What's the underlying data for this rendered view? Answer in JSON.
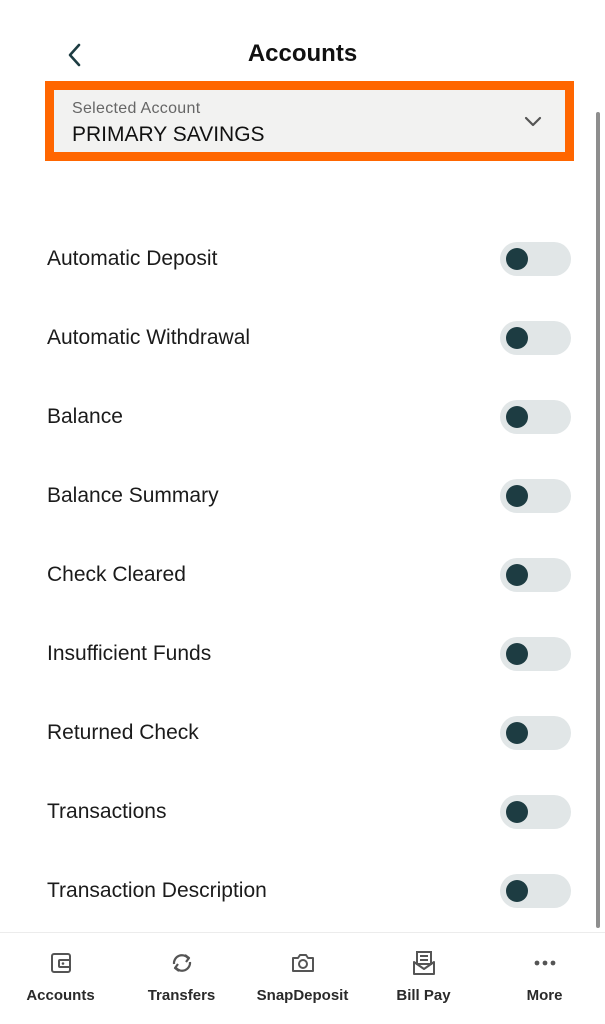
{
  "header": {
    "title": "Accounts",
    "back_icon": "chevron-left-icon"
  },
  "account_selector": {
    "label": "Selected Account",
    "value": "PRIMARY SAVINGS",
    "icon": "chevron-down-icon",
    "highlight_color": "#ff6600"
  },
  "alerts": [
    {
      "label": "Automatic Deposit",
      "enabled": false
    },
    {
      "label": "Automatic Withdrawal",
      "enabled": false
    },
    {
      "label": "Balance",
      "enabled": false
    },
    {
      "label": "Balance Summary",
      "enabled": false
    },
    {
      "label": "Check Cleared",
      "enabled": false
    },
    {
      "label": "Insufficient Funds",
      "enabled": false
    },
    {
      "label": "Returned Check",
      "enabled": false
    },
    {
      "label": "Transactions",
      "enabled": false
    },
    {
      "label": "Transaction Description",
      "enabled": false
    }
  ],
  "tabbar": {
    "items": [
      {
        "label": "Accounts",
        "icon": "wallet-icon"
      },
      {
        "label": "Transfers",
        "icon": "transfer-arrows-icon"
      },
      {
        "label": "SnapDeposit",
        "icon": "camera-icon"
      },
      {
        "label": "Bill Pay",
        "icon": "bill-envelope-icon"
      },
      {
        "label": "More",
        "icon": "more-dots-icon"
      }
    ]
  },
  "colors": {
    "accent": "#1d3c42",
    "toggle_track": "#e1e6e7"
  }
}
